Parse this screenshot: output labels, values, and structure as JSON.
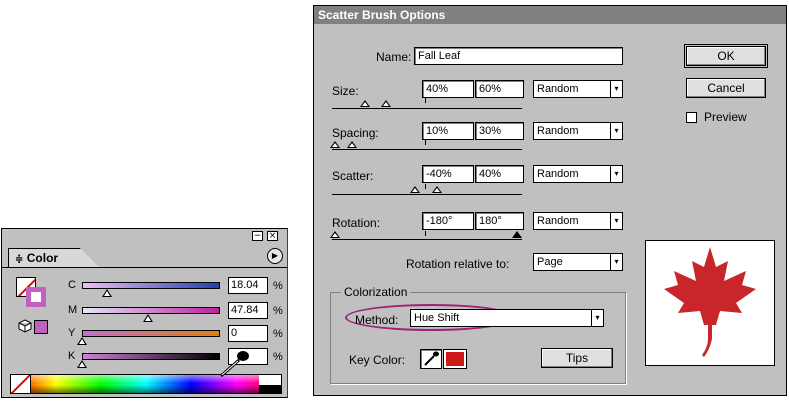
{
  "color_palette": {
    "title_buttons": {
      "minimize": "−",
      "close": "×"
    },
    "tab_label": "Color",
    "tab_glyph": "≑",
    "menu_glyph": "▶",
    "fill_color": "#c060c0",
    "channels": [
      {
        "letter": "C",
        "value": "18.04",
        "unit": "%",
        "level": 0.18,
        "gradient": [
          "#f0c0f0",
          "#2040b0"
        ]
      },
      {
        "letter": "M",
        "value": "47.84",
        "unit": "%",
        "level": 0.48,
        "gradient": [
          "#e0e8f8",
          "#c020a0"
        ]
      },
      {
        "letter": "Y",
        "value": "0",
        "unit": "%",
        "level": 0.0,
        "gradient": [
          "#c070d0",
          "#e08010"
        ]
      },
      {
        "letter": "K",
        "value": "",
        "unit": "%",
        "level": 0.0,
        "gradient": [
          "#d080d8",
          "#000000"
        ]
      }
    ]
  },
  "dialog": {
    "title": "Scatter Brush Options",
    "name_label": "Name:",
    "name_value": "Fall Leaf",
    "rows": [
      {
        "label": "Size:",
        "min": "40%",
        "max": "60%",
        "mode": "Random"
      },
      {
        "label": "Spacing:",
        "min": "10%",
        "max": "30%",
        "mode": "Random"
      },
      {
        "label": "Scatter:",
        "min": "-40%",
        "max": "40%",
        "mode": "Random"
      },
      {
        "label": "Rotation:",
        "min": "-180°",
        "max": "180°",
        "mode": "Random"
      }
    ],
    "rotation_relative_label": "Rotation relative to:",
    "rotation_relative_value": "Page",
    "colorization": {
      "group_label": "Colorization",
      "method_label": "Method:",
      "method_value": "Hue Shift",
      "key_color_label": "Key Color:",
      "key_color": "#cc1b16",
      "tips_label": "Tips"
    },
    "ok_label": "OK",
    "cancel_label": "Cancel",
    "preview_label": "Preview",
    "preview_checked": false,
    "leaf_color": "#c8262a",
    "dropdown_arrow": "▾"
  }
}
